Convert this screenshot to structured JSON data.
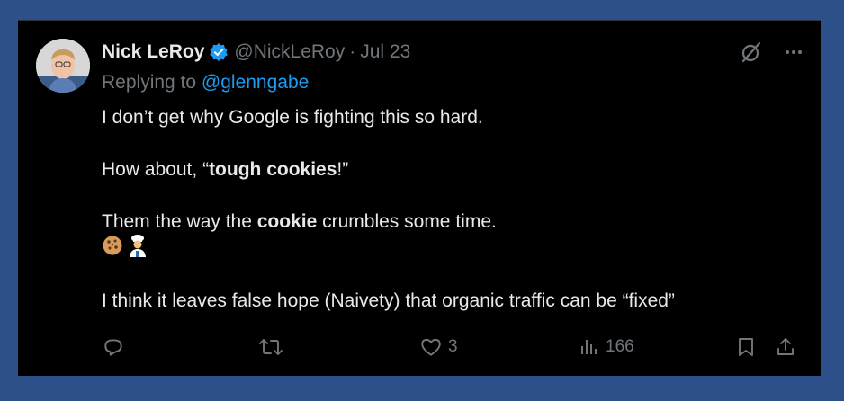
{
  "author": {
    "display_name": "Nick LeRoy",
    "handle": "@NickLeRoy",
    "separator": "·",
    "date": "Jul 23"
  },
  "reply": {
    "prefix": "Replying to ",
    "mention": "@glenngabe"
  },
  "body": {
    "line1": "I don’t get why Google is fighting this so hard.",
    "line2_pre": "How about, “",
    "line2_bold": "tough cookies",
    "line2_post": "!”",
    "line3_pre": "Them the way the ",
    "line3_bold": "cookie",
    "line3_post": " crumbles some time.",
    "emojis": [
      "cookie-emoji",
      "cook-emoji"
    ],
    "line4": "I think it leaves false hope (Naivety) that organic traffic can be “fixed”"
  },
  "actions": {
    "reply_count": "",
    "retweet_count": "",
    "like_count": "3",
    "view_count": "166"
  },
  "colors": {
    "background": "#2d4f8a",
    "card": "#000000",
    "text": "#e7e9ea",
    "muted": "#71767b",
    "accent": "#1d9bf0"
  },
  "icons": [
    "verified-badge-icon",
    "grok-icon",
    "more-icon",
    "reply-icon",
    "retweet-icon",
    "like-icon",
    "views-icon",
    "bookmark-icon",
    "share-icon"
  ]
}
